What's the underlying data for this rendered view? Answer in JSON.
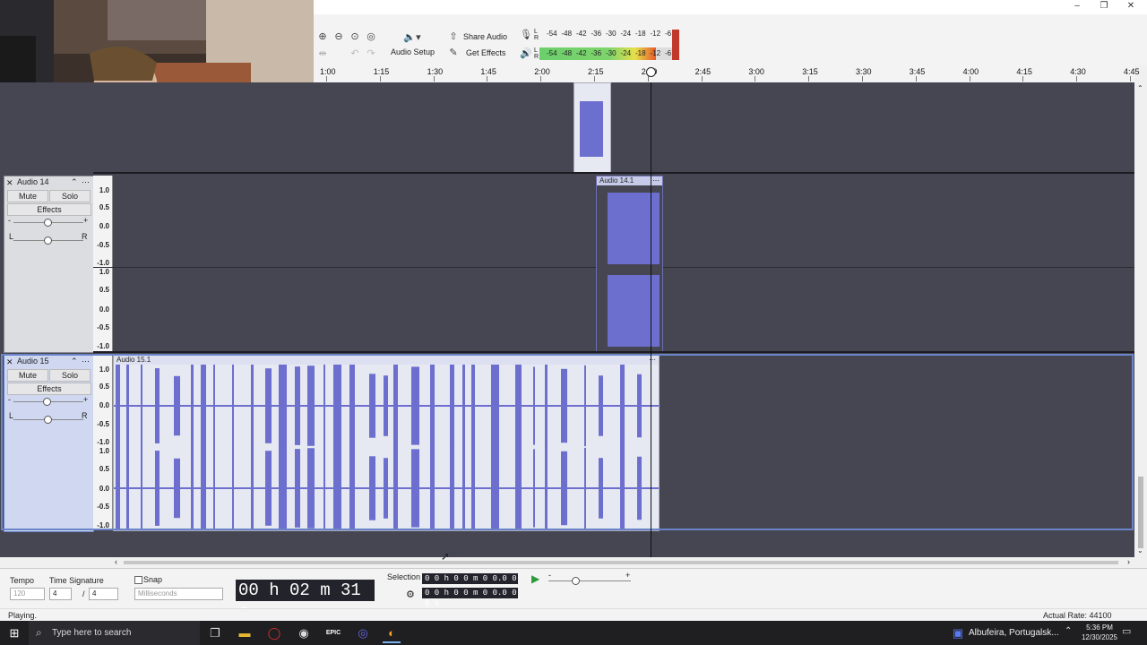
{
  "window": {
    "minimize_icon": "–",
    "restore_icon": "❐",
    "close_icon": "✕"
  },
  "toolbar": {
    "zoom_icons": [
      "zoom-in-icon",
      "zoom-out-icon",
      "zoom-selection-icon",
      "zoom-fit-icon"
    ],
    "audio_setup_label": "Audio Setup",
    "audio_setup_icon": "🔈▾",
    "share_audio_label": "Share Audio",
    "get_effects_label": "Get Effects",
    "meter_scale": [
      "-54",
      "-48",
      "-42",
      "-36",
      "-30",
      "-24",
      "-18",
      "-12",
      "-6"
    ],
    "meter_rec_lr": [
      "L",
      "R"
    ],
    "meter_play_lr": [
      "L",
      "R"
    ],
    "meter_play_level": 0.88
  },
  "ruler": {
    "ticks": [
      "1:00",
      "1:15",
      "1:30",
      "1:45",
      "2:00",
      "2:15",
      "2:30",
      "2:45",
      "3:00",
      "3:15",
      "3:30",
      "3:45",
      "4:00",
      "4:15",
      "4:30",
      "4:45"
    ]
  },
  "tracks": [
    {
      "name": "Audio 14",
      "mute": "Mute",
      "solo": "Solo",
      "effects": "Effects",
      "gain_minus": "-",
      "gain_plus": "+",
      "pan_l": "L",
      "pan_r": "R",
      "clip_name": "Audio 14.1",
      "scale": [
        "1.0",
        "0.5",
        "0.0",
        "-0.5",
        "-1.0"
      ]
    },
    {
      "name": "Audio 15",
      "mute": "Mute",
      "solo": "Solo",
      "effects": "Effects",
      "gain_minus": "-",
      "gain_plus": "+",
      "pan_l": "L",
      "pan_r": "R",
      "clip_name": "Audio 15.1",
      "scale": [
        "1.0",
        "0.5",
        "0.0",
        "-0.5",
        "-1.0"
      ]
    }
  ],
  "bottom": {
    "tempo_label": "Tempo",
    "tempo_value": "120",
    "time_sig_label": "Time Signature",
    "time_sig_num": "4",
    "time_sig_slash": "/",
    "time_sig_den": "4",
    "snap_label": "Snap",
    "snap_unit": "Milliseconds",
    "time_display": "00 h 02 m 31 s",
    "selection_label": "Selection",
    "selection_start": "0 0 h 0 0 m 0 0.0 0 0 s",
    "selection_end": "0 0 h 0 0 m 0 0.0 0 0 s",
    "speed_minus": "-",
    "speed_plus": "+"
  },
  "status": {
    "left": "Playing.",
    "right": "Actual Rate: 44100"
  },
  "taskbar": {
    "search_placeholder": "Type here to search",
    "weather": "Albufeira, Portugalsk...",
    "time": "5:36 PM",
    "date": "12/30/2025",
    "epic_label": "EPIC"
  }
}
